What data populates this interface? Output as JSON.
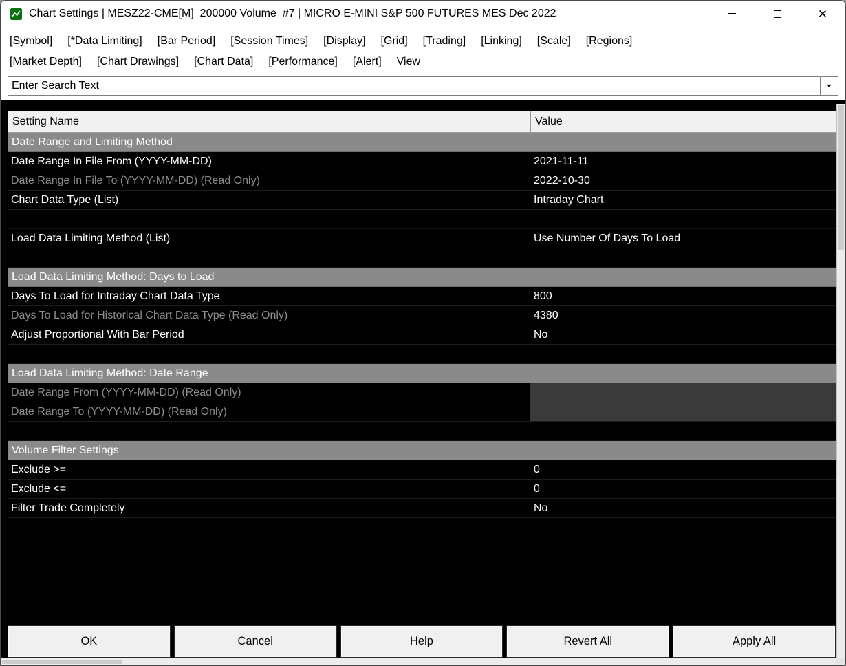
{
  "window": {
    "title": "Chart Settings | MESZ22-CME[M]  200000 Volume  #7 | MICRO E-MINI S&P 500 FUTURES MES Dec 2022"
  },
  "icons": {
    "close": "✕",
    "dropdown_arrow": "▼"
  },
  "menu": {
    "row1": [
      "[Symbol]",
      "[*Data Limiting]",
      "[Bar Period]",
      "[Session Times]",
      "[Display]",
      "[Grid]",
      "[Trading]",
      "[Linking]",
      "[Scale]",
      "[Regions]"
    ],
    "row2": [
      "[Market Depth]",
      "[Chart Drawings]",
      "[Chart Data]",
      "[Performance]",
      "[Alert]",
      "View"
    ]
  },
  "search": {
    "placeholder": "Enter Search Text"
  },
  "table": {
    "headers": [
      "Setting Name",
      "Value"
    ],
    "rows": [
      {
        "type": "section",
        "label": "Date Range and Limiting Method"
      },
      {
        "type": "setting",
        "label": "Date Range In File From (YYYY-MM-DD)",
        "value": "2021-11-11",
        "readonly": false
      },
      {
        "type": "setting",
        "label": "Date Range In File To (YYYY-MM-DD) (Read Only)",
        "value": "2022-10-30",
        "readonly": true
      },
      {
        "type": "setting",
        "label": "Chart Data Type (List)",
        "value": "Intraday Chart",
        "readonly": false
      },
      {
        "type": "blank"
      },
      {
        "type": "setting",
        "label": "Load Data Limiting Method (List)",
        "value": "Use Number Of Days To Load",
        "readonly": false
      },
      {
        "type": "blank"
      },
      {
        "type": "section",
        "label": "Load Data Limiting Method: Days to Load"
      },
      {
        "type": "setting",
        "label": "Days To Load for Intraday Chart Data Type",
        "value": "800",
        "readonly": false
      },
      {
        "type": "setting",
        "label": "Days To Load for Historical Chart Data Type (Read Only)",
        "value": "4380",
        "readonly": true
      },
      {
        "type": "setting",
        "label": "Adjust Proportional With Bar Period",
        "value": "No",
        "readonly": false
      },
      {
        "type": "blank"
      },
      {
        "type": "section",
        "label": "Load Data Limiting Method: Date Range"
      },
      {
        "type": "setting",
        "label": "Date Range From (YYYY-MM-DD) (Read Only)",
        "value": "",
        "readonly": true
      },
      {
        "type": "setting",
        "label": "Date Range To (YYYY-MM-DD) (Read Only)",
        "value": "",
        "readonly": true
      },
      {
        "type": "blank"
      },
      {
        "type": "section",
        "label": "Volume Filter Settings"
      },
      {
        "type": "setting",
        "label": "Exclude >=",
        "value": "0",
        "readonly": false
      },
      {
        "type": "setting",
        "label": "Exclude <=",
        "value": "0",
        "readonly": false
      },
      {
        "type": "setting",
        "label": "Filter Trade Completely",
        "value": "No",
        "readonly": false
      }
    ]
  },
  "buttons": [
    "OK",
    "Cancel",
    "Help",
    "Revert All",
    "Apply All"
  ]
}
